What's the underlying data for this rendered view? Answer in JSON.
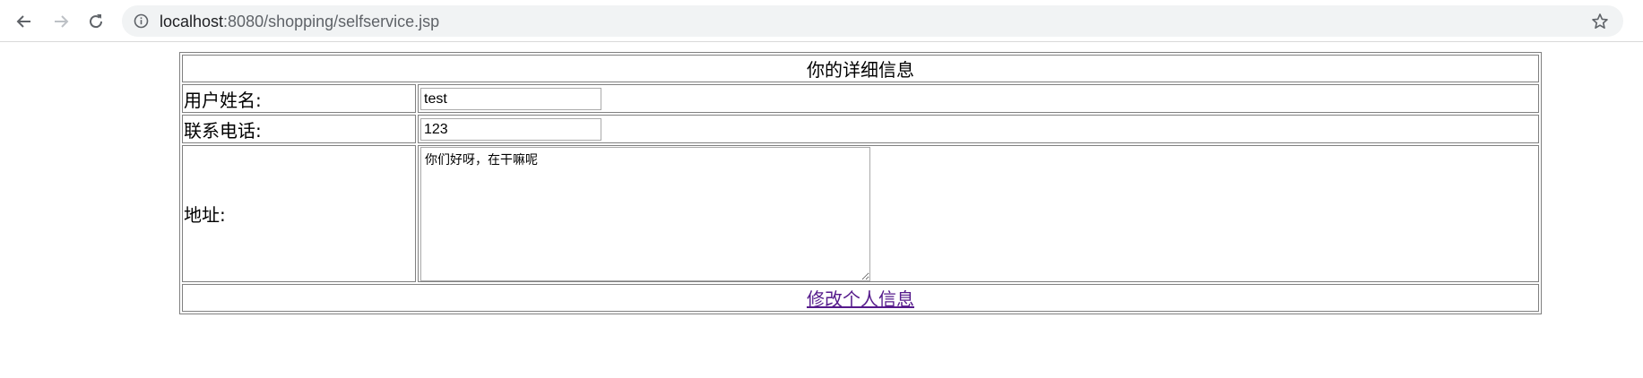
{
  "browser": {
    "url_host": "localhost",
    "url_path": ":8080/shopping/selfservice.jsp",
    "icons": {
      "back": "back-arrow-icon",
      "forward": "forward-arrow-icon",
      "reload": "reload-icon",
      "info": "info-icon",
      "bookmark": "star-icon"
    }
  },
  "form": {
    "title": "你的详细信息",
    "username_label": "用户姓名:",
    "username_value": "test",
    "phone_label": "联系电话:",
    "phone_value": "123",
    "address_label": "地址:",
    "address_value": "你们好呀，在干嘛呢",
    "edit_link": "修改个人信息"
  },
  "colors": {
    "link_visited": "#551a8b",
    "table_border": "#808080"
  }
}
